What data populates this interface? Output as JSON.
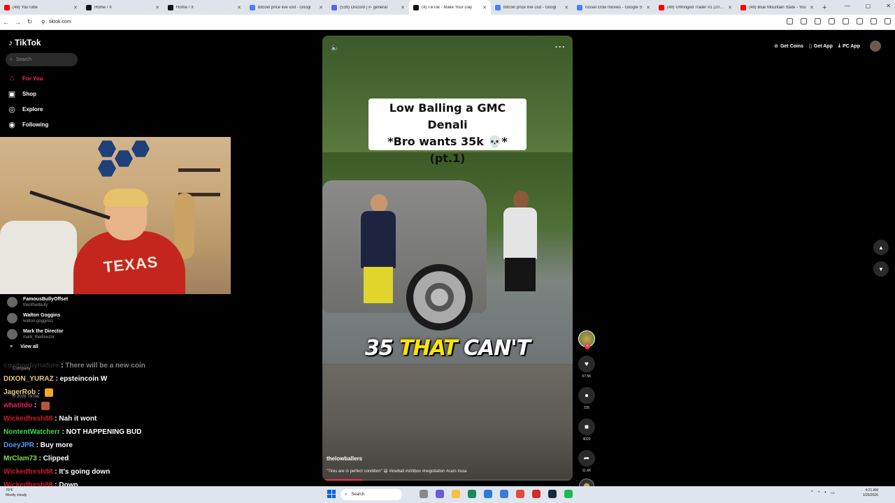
{
  "browser": {
    "tabs": [
      {
        "title": "(49) YouTube",
        "color": "#ff0000",
        "active": false
      },
      {
        "title": "Home / X",
        "color": "#111111",
        "active": false
      },
      {
        "title": "Home / X",
        "color": "#111111",
        "active": false
      },
      {
        "title": "bitcoin price live usd - Googl",
        "color": "#4285f4",
        "active": false
      },
      {
        "title": "(539) Discord | #- general",
        "color": "#5865f2",
        "active": false
      },
      {
        "title": "(4) TikTok - Make Your Day",
        "color": "#111111",
        "active": true
      },
      {
        "title": "bitcoin price live usd - Googl",
        "color": "#4285f4",
        "active": false
      },
      {
        "title": "russel crow movies - Google S",
        "color": "#4285f4",
        "active": false
      },
      {
        "title": "(49) Unhinged Trailer #1 (2024)",
        "color": "#ff0000",
        "active": false
      },
      {
        "title": "(49) Blue Mountain State - You",
        "color": "#ff0000",
        "active": false
      }
    ],
    "url": "tiktok.com"
  },
  "tiktok": {
    "logo": "TikTok",
    "search_placeholder": "Search",
    "nav": [
      {
        "label": "For You",
        "icon": "home-icon",
        "glyph": "⌂"
      },
      {
        "label": "Shop",
        "icon": "shop-icon",
        "glyph": "▣"
      },
      {
        "label": "Explore",
        "icon": "compass-icon",
        "glyph": "◎"
      },
      {
        "label": "Following",
        "icon": "following-icon",
        "glyph": "◉"
      }
    ],
    "following_accounts": [
      {
        "name": "FamousBullyOffset",
        "handle": "theoffsetbully"
      },
      {
        "name": "Walton Goggins",
        "handle": "walton.goggins1"
      },
      {
        "name": "Mark the Director",
        "handle": "mark_thedirector"
      }
    ],
    "view_all": "View all",
    "footer_company": "Company",
    "footer_copyright": "© 2026 TikTok",
    "top_buttons": {
      "coins": "Get Coins",
      "app": "Get App",
      "pc": "PC App"
    },
    "video": {
      "caption_line1": "Low Balling a GMC Denali",
      "caption_line2": "*Bro wants 35k 💀*",
      "caption_line3": "(pt.1)",
      "subtitle_white": "35",
      "subtitle_yellow": "THAT",
      "subtitle_white2": "CAN'T",
      "username": "thelowballers",
      "description": "\"Tires are in perfect condition\" 😅 #lowball #shitbox #negotiation #cars #usa",
      "progress": 0.16
    },
    "actions": {
      "likes": "67.5K",
      "comments": "235",
      "saves": "4020",
      "shares": "11.6K"
    }
  },
  "chat": [
    {
      "user": "cowboybynature",
      "color": "#555555",
      "message": "There will be a new coin",
      "dim": true
    },
    {
      "user": "DIXON_YURAZ",
      "color": "#e8c77a",
      "message": "epsteincoin W",
      "dim": false
    },
    {
      "user": "JagerRob",
      "color": "#e8c77a",
      "message": "",
      "dim": false
    },
    {
      "user": "whatitdo",
      "color": "#e0245e",
      "message": "",
      "dim": false
    },
    {
      "user": "Wickedfresh88",
      "color": "#d11a2a",
      "message": "Nah it wont",
      "dim": false
    },
    {
      "user": "NontentWatcherr",
      "color": "#3ddc4a",
      "message": "NOT HAPPENING BUD",
      "dim": false
    },
    {
      "user": "DoeyJPR",
      "color": "#4a9bff",
      "message": "Buy more",
      "dim": false
    },
    {
      "user": "MrClam73",
      "color": "#7ce04a",
      "message": "Clipped",
      "dim": false
    },
    {
      "user": "Wickedfresh88",
      "color": "#d11a2a",
      "message": "It's going down",
      "dim": false
    },
    {
      "user": "Wickedfresh88",
      "color": "#d11a2a",
      "message": "Down",
      "dim": false
    }
  ],
  "taskbar": {
    "weather_temp": "70°F",
    "weather_desc": "Mostly cloudy",
    "search_label": "Search",
    "time": "4:21 AM",
    "date": "1/25/2026"
  }
}
